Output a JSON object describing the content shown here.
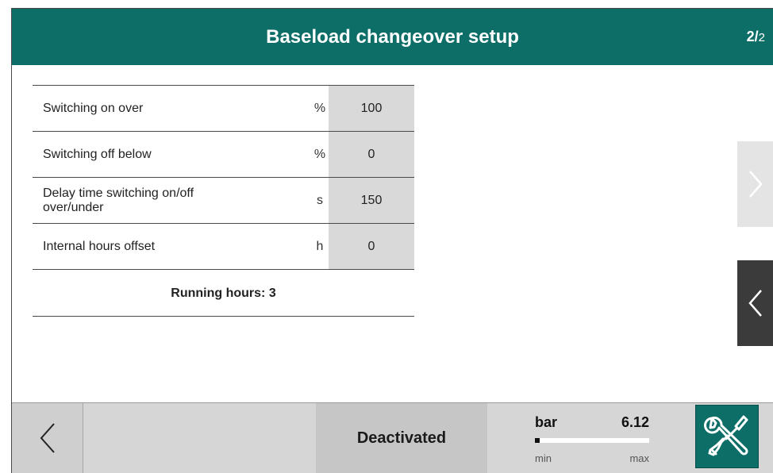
{
  "header": {
    "title": "Baseload changeover setup",
    "page_current": "2",
    "page_separator": "/",
    "page_total": "2"
  },
  "settings": {
    "rows": [
      {
        "label": "Switching on over",
        "unit": "%",
        "value": "100"
      },
      {
        "label": "Switching off below",
        "unit": "%",
        "value": "0"
      },
      {
        "label": "Delay time switching on/off over/under",
        "unit": "s",
        "value": "150"
      },
      {
        "label": "Internal hours offset",
        "unit": "h",
        "value": "0"
      }
    ],
    "running_hours": "Running hours: 3"
  },
  "footer": {
    "status": "Deactivated",
    "gauge": {
      "unit": "bar",
      "value": "6.12",
      "min_label": "min",
      "max_label": "max",
      "fill_fraction": 0.04
    }
  },
  "icons": {
    "back": "chevron-left-icon",
    "next_page": "chevron-right-icon",
    "prev_page": "chevron-left-icon",
    "tools": "wrench-screwdriver-icon"
  },
  "colors": {
    "accent": "#0d6e68",
    "panel": "#d6d6d6",
    "value_cell": "#d9d9d9",
    "nav_dark": "#3b3b3b"
  }
}
